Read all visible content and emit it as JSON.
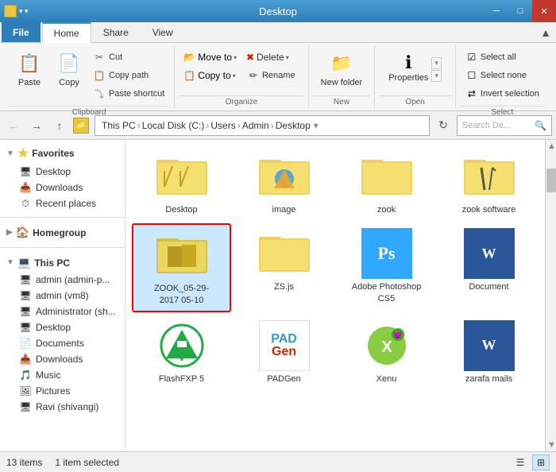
{
  "titleBar": {
    "title": "Desktop",
    "minimizeLabel": "─",
    "maximizeLabel": "□",
    "closeLabel": "✕"
  },
  "ribbonTabs": {
    "file": "File",
    "home": "Home",
    "share": "Share",
    "view": "View"
  },
  "ribbon": {
    "clipboard": {
      "label": "Clipboard",
      "copy": "Copy",
      "paste": "Paste",
      "cut": "Cut",
      "copyPath": "Copy path",
      "pasteShortcut": "Paste shortcut"
    },
    "organize": {
      "label": "Organize",
      "moveTo": "Move to",
      "copyTo": "Copy to",
      "delete": "Delete",
      "rename": "Rename"
    },
    "new": {
      "label": "New",
      "newFolder": "New folder"
    },
    "open": {
      "label": "Open",
      "properties": "Properties"
    },
    "select": {
      "label": "Select",
      "selectAll": "Select all",
      "selectNone": "Select none",
      "invertSelection": "Invert selection"
    }
  },
  "addressBar": {
    "thisPc": "This PC",
    "localDisk": "Local Disk (C:)",
    "users": "Users",
    "admin": "Admin",
    "desktop": "Desktop",
    "searchPlaceholder": "Search De..."
  },
  "sidebar": {
    "favorites": {
      "label": "Favorites",
      "items": [
        {
          "label": "Desktop",
          "icon": "🖥"
        },
        {
          "label": "Downloads",
          "icon": "📥"
        },
        {
          "label": "Recent places",
          "icon": "⏱"
        }
      ]
    },
    "homegroup": {
      "label": "Homegroup"
    },
    "thisPC": {
      "label": "This PC",
      "items": [
        {
          "label": "admin (admin-p..."
        },
        {
          "label": "admin (vm8)"
        },
        {
          "label": "Administrator (sh..."
        },
        {
          "label": "Desktop"
        },
        {
          "label": "Documents"
        },
        {
          "label": "Downloads"
        },
        {
          "label": "Music"
        },
        {
          "label": "Pictures"
        },
        {
          "label": "Ravi (shivangi)"
        }
      ]
    }
  },
  "files": [
    {
      "name": "Desktop",
      "type": "folder",
      "selected": false
    },
    {
      "name": "image",
      "type": "folder-image",
      "selected": false
    },
    {
      "name": "zook",
      "type": "folder",
      "selected": false
    },
    {
      "name": "zook software",
      "type": "folder-pencil",
      "selected": false
    },
    {
      "name": "ZOOK_05-29-2017 05-10",
      "type": "folder-selected",
      "selected": true
    },
    {
      "name": "ZS.js",
      "type": "folder-js",
      "selected": false
    },
    {
      "name": "Adobe Photoshop CS5",
      "type": "photoshop",
      "selected": false
    },
    {
      "name": "Document",
      "type": "word",
      "selected": false
    },
    {
      "name": "FlashFXP 5",
      "type": "flashfxp",
      "selected": false
    },
    {
      "name": "PADGen",
      "type": "padgen",
      "selected": false
    },
    {
      "name": "Xenu",
      "type": "xenu",
      "selected": false
    },
    {
      "name": "zarafa mails",
      "type": "zarafa",
      "selected": false
    }
  ],
  "statusBar": {
    "itemCount": "13 items",
    "selectedCount": "1 item selected"
  }
}
